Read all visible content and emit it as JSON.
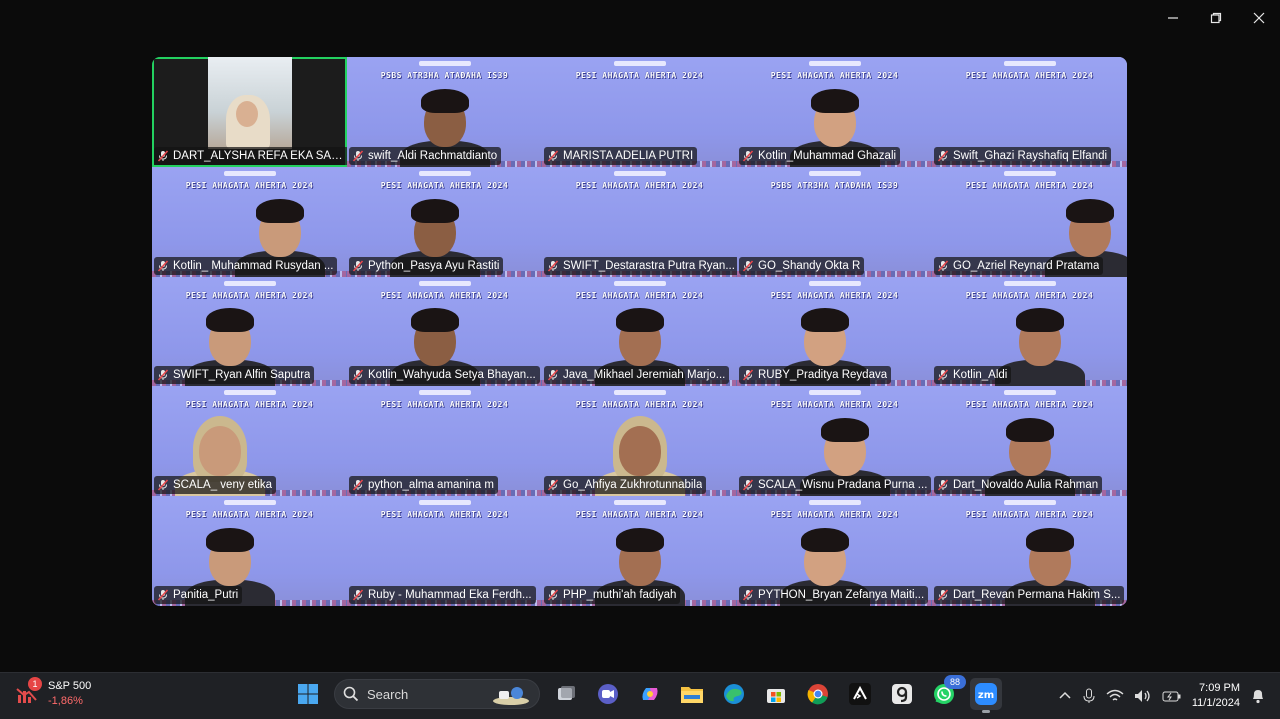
{
  "window": {
    "controls": [
      "minimize-icon",
      "restore-icon",
      "close-icon"
    ]
  },
  "meeting": {
    "banner_text": "PESI AHAGATA AHERTA 2024",
    "banner_text_mirrored": "PSBS ATR3HA ATAĐAHA IS39",
    "participants": [
      {
        "name": "DART_ALYSHA REFA EKA SALS...",
        "muted": true,
        "active_speaker": true,
        "video": "camera"
      },
      {
        "name": "swift_Aldi Rachmatdianto",
        "muted": true,
        "video": "background"
      },
      {
        "name": "MARISTA ADELIA PUTRI",
        "muted": true,
        "video": "background"
      },
      {
        "name": "Kotlin_Muhammad Ghazali",
        "muted": true,
        "video": "background"
      },
      {
        "name": "Swift_Ghazi Rayshafiq Elfandi",
        "muted": true,
        "video": "background"
      },
      {
        "name": "Kotlin_ Muhammad Rusydan ...",
        "muted": true,
        "video": "background"
      },
      {
        "name": "Python_Pasya Ayu Rastiti",
        "muted": true,
        "video": "background"
      },
      {
        "name": "SWIFT_Destarastra Putra Ryan...",
        "muted": true,
        "video": "background"
      },
      {
        "name": "GO_Shandy Okta R",
        "muted": true,
        "video": "background"
      },
      {
        "name": "GO_Azriel Reynard Pratama",
        "muted": true,
        "video": "background"
      },
      {
        "name": "SWIFT_Ryan Alfin Saputra",
        "muted": true,
        "video": "background"
      },
      {
        "name": "Kotlin_Wahyuda Setya Bhayan...",
        "muted": true,
        "video": "background"
      },
      {
        "name": "Java_Mikhael Jeremiah Marjo...",
        "muted": true,
        "video": "background"
      },
      {
        "name": "RUBY_Praditya Reydava",
        "muted": true,
        "video": "background"
      },
      {
        "name": "Kotlin_Aldi",
        "muted": true,
        "video": "background"
      },
      {
        "name": "SCALA_ veny etika",
        "muted": true,
        "video": "background"
      },
      {
        "name": "python_alma amanina m",
        "muted": true,
        "video": "background"
      },
      {
        "name": "Go_Ahfiya Zukhrotunnabila",
        "muted": true,
        "video": "background"
      },
      {
        "name": "SCALA_Wisnu Pradana Purna ...",
        "muted": true,
        "video": "background"
      },
      {
        "name": "Dart_Novaldo Aulia Rahman",
        "muted": true,
        "video": "background"
      },
      {
        "name": "Panitia_Putri",
        "muted": true,
        "video": "background"
      },
      {
        "name": "Ruby - Muhammad Eka Ferdh...",
        "muted": true,
        "video": "background"
      },
      {
        "name": "PHP_muthi'ah fadiyah",
        "muted": true,
        "video": "background"
      },
      {
        "name": "PYTHON_Bryan Zefanya Maiti...",
        "muted": true,
        "video": "background"
      },
      {
        "name": "Dart_Revan Permana Hakim S...",
        "muted": true,
        "video": "background"
      }
    ]
  },
  "taskbar": {
    "widget": {
      "title": "S&P 500",
      "change": "-1,86%",
      "badge": "1"
    },
    "search_placeholder": "Search",
    "whatsapp_badge": "88",
    "apps": [
      "windows-start-icon",
      "search-icon",
      "task-view-icon",
      "zoom-chat-icon",
      "copilot-icon",
      "file-explorer-icon",
      "edge-icon",
      "store-icon",
      "chrome-icon",
      "terminal-icon",
      "notes-icon",
      "whatsapp-icon",
      "zoom-icon"
    ],
    "clock": {
      "time": "7:09 PM",
      "date": "11/1/2024"
    }
  },
  "colors": {
    "accent_active": "#23d160",
    "tile_bg": "#9aa3f2",
    "taskbar_bg": "#1f2125"
  }
}
